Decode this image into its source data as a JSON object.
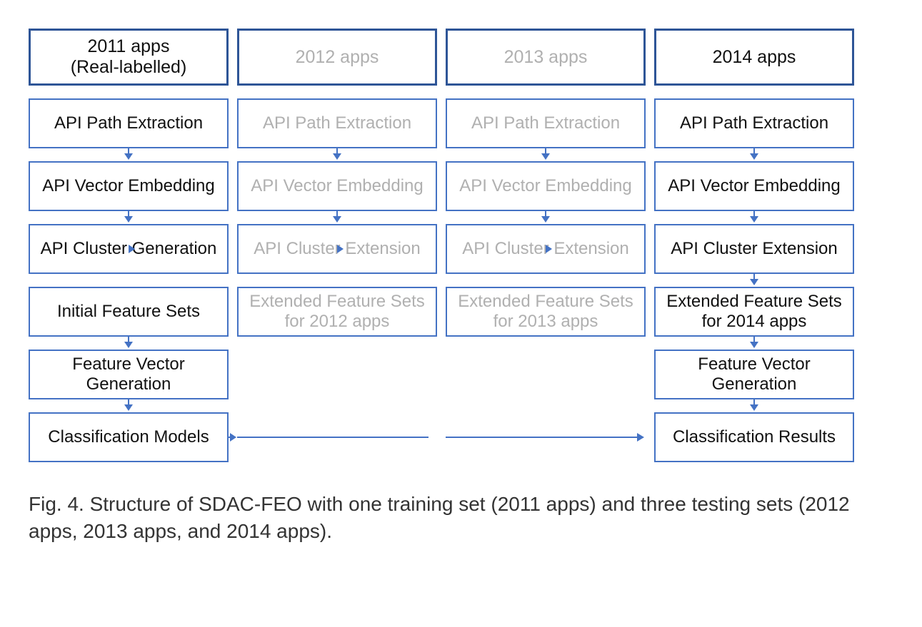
{
  "columns": [
    {
      "header": "2011 apps\n(Real-labelled)",
      "faded": false,
      "rows": [
        "API Path Extraction",
        "API Vector Embedding",
        "API Cluster Generation",
        "Initial Feature Sets",
        "Feature Vector Generation",
        "Classification Models"
      ]
    },
    {
      "header": "2012 apps",
      "faded": true,
      "rows": [
        "API Path Extraction",
        "API Vector Embedding",
        "API Cluster Extension",
        "Extended Feature Sets for 2012 apps",
        "",
        ""
      ]
    },
    {
      "header": "2013 apps",
      "faded": true,
      "rows": [
        "API Path Extraction",
        "API Vector Embedding",
        "API Cluster Extension",
        "Extended Feature Sets for 2013 apps",
        "",
        ""
      ]
    },
    {
      "header": "2014 apps",
      "faded": false,
      "rows": [
        "API Path Extraction",
        "API Vector Embedding",
        "API Cluster Extension",
        "Extended Feature Sets for 2014 apps",
        "Feature Vector Generation",
        "Classification Results"
      ]
    }
  ],
  "caption": "Fig. 4. Structure of SDAC-FEO with one training set (2011 apps) and three testing sets (2012 apps, 2013 apps, and 2014 apps)."
}
